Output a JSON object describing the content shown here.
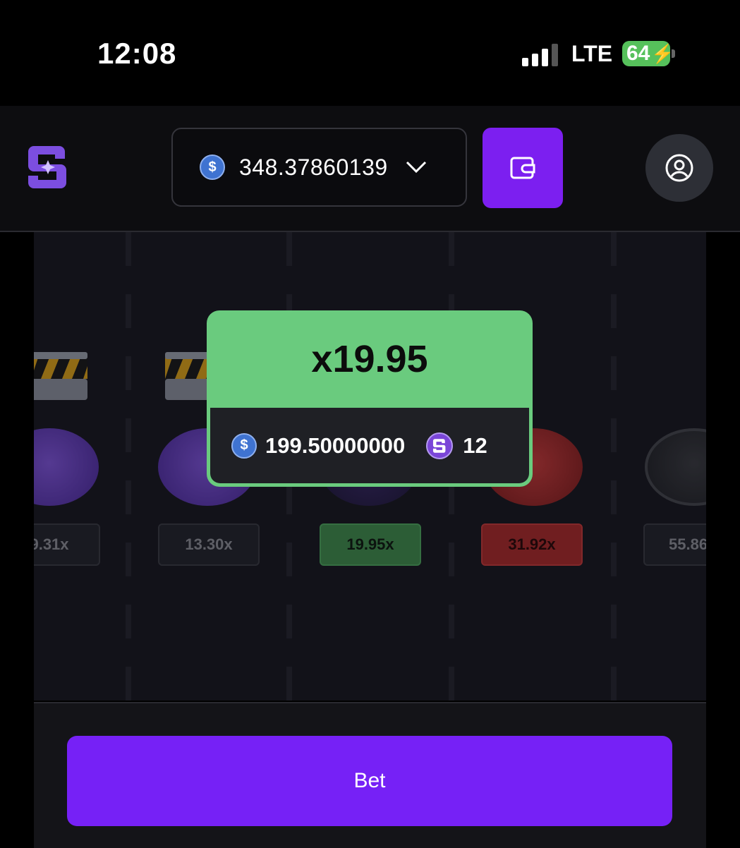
{
  "status_bar": {
    "time": "12:08",
    "network": "LTE",
    "battery": "64"
  },
  "header": {
    "balance": "348.37860139",
    "currency_icon": "usdc-coin-icon",
    "wallet_icon": "wallet-icon",
    "profile_icon": "user-icon",
    "logo_icon": "brand-logo-icon"
  },
  "game": {
    "lanes": [
      {
        "multiplier": "9.31x",
        "state": "passed",
        "coin": "brand-chip"
      },
      {
        "multiplier": "13.30x",
        "state": "passed",
        "coin": "brand-chip"
      },
      {
        "multiplier": "19.95x",
        "state": "current",
        "coin": "chip"
      },
      {
        "multiplier": "31.92x",
        "state": "danger",
        "coin": "skull-chip"
      },
      {
        "multiplier": "55.86",
        "state": "upcoming",
        "coin": "locked-chip"
      }
    ]
  },
  "result": {
    "multiplier": "x19.95",
    "win_amount": "199.50000000",
    "tokens": "12"
  },
  "footer": {
    "bet_label": "Bet"
  },
  "colors": {
    "accent": "#7621f6",
    "win": "#6acb7e",
    "danger": "#c33a3a"
  }
}
